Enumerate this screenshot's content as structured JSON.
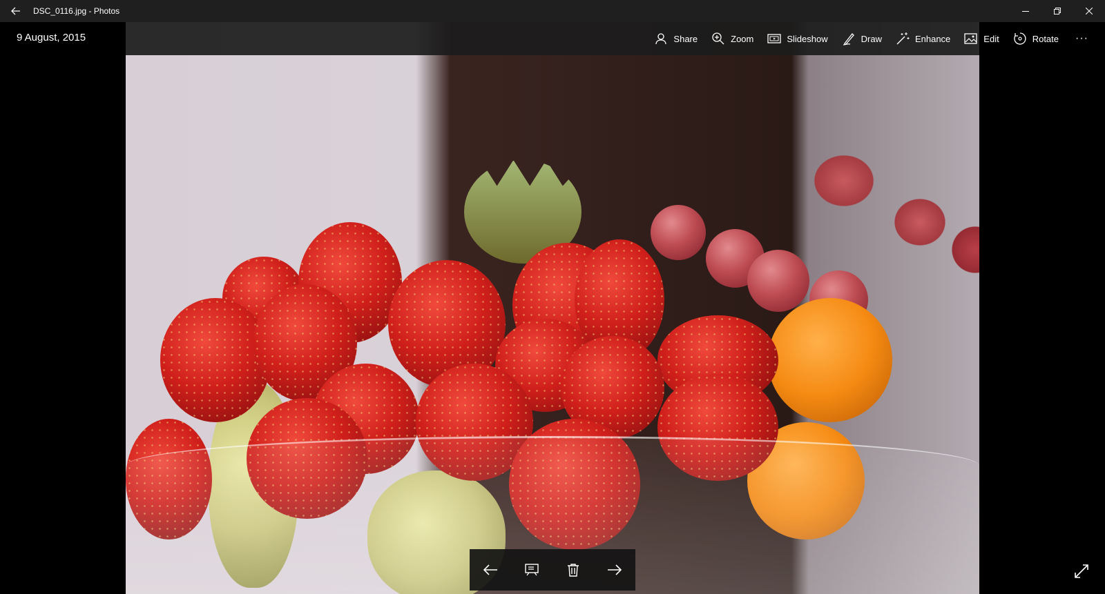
{
  "window": {
    "title": "DSC_0116.jpg - Photos",
    "back_icon": "back-arrow-icon",
    "controls": [
      "minimize-icon",
      "restore-icon",
      "close-icon"
    ]
  },
  "photo": {
    "date": "9 August, 2015",
    "description_icon": "photo-fruit-bowl"
  },
  "commands": [
    {
      "label": "Share",
      "icon": "share-icon"
    },
    {
      "label": "Zoom",
      "icon": "zoom-icon"
    },
    {
      "label": "Slideshow",
      "icon": "slideshow-icon"
    },
    {
      "label": "Draw",
      "icon": "draw-icon"
    },
    {
      "label": "Enhance",
      "icon": "enhance-icon"
    },
    {
      "label": "Edit",
      "icon": "edit-icon"
    },
    {
      "label": "Rotate",
      "icon": "rotate-icon"
    }
  ],
  "more_label": "···",
  "bottom_controls": [
    "previous-icon",
    "present-icon",
    "delete-icon",
    "next-icon"
  ],
  "fullscreen_icon": "fullscreen-icon",
  "colors": {
    "titlebar": "#1f1f1f",
    "commandbar": "#1c1c1c",
    "background": "#000000"
  }
}
